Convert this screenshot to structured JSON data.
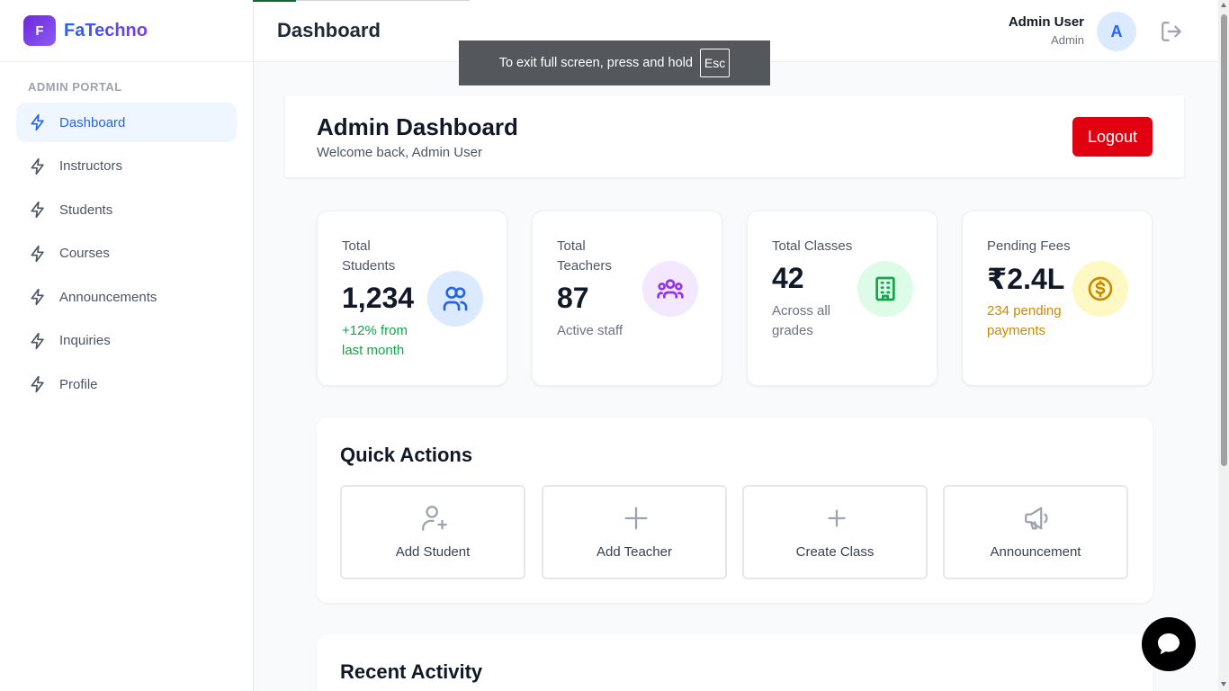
{
  "brand": {
    "logo_letter": "F",
    "name": "FaTechno"
  },
  "sidebar": {
    "section_label": "ADMIN PORTAL",
    "items": [
      {
        "label": "Dashboard",
        "active": true
      },
      {
        "label": "Instructors",
        "active": false
      },
      {
        "label": "Students",
        "active": false
      },
      {
        "label": "Courses",
        "active": false
      },
      {
        "label": "Announcements",
        "active": false
      },
      {
        "label": "Inquiries",
        "active": false
      },
      {
        "label": "Profile",
        "active": false
      }
    ]
  },
  "header": {
    "title": "Dashboard",
    "user_name": "Admin User",
    "user_role": "Admin",
    "avatar_letter": "A"
  },
  "fullscreen_toast": {
    "text": "To exit full screen, press and hold",
    "key": "Esc"
  },
  "admin_card": {
    "title": "Admin Dashboard",
    "subtitle": "Welcome back, Admin User",
    "logout_label": "Logout"
  },
  "stats": [
    {
      "label": "Total Students",
      "value": "1,234",
      "note": "+12% from last month",
      "icon": "users-icon"
    },
    {
      "label": "Total Teachers",
      "value": "87",
      "note": "Active staff",
      "icon": "group-icon"
    },
    {
      "label": "Total Classes",
      "value": "42",
      "note": "Across all grades",
      "icon": "building-icon"
    },
    {
      "label": "Pending Fees",
      "value": "₹2.4L",
      "note": "234 pending payments",
      "icon": "dollar-icon"
    }
  ],
  "quick_actions": {
    "title": "Quick Actions",
    "items": [
      {
        "label": "Add Student",
        "icon": "user-plus-icon"
      },
      {
        "label": "Add Teacher",
        "icon": "plus-icon"
      },
      {
        "label": "Create Class",
        "icon": "plus-icon"
      },
      {
        "label": "Announcement",
        "icon": "megaphone-icon"
      }
    ]
  },
  "recent_activity": {
    "title": "Recent Activity"
  },
  "colors": {
    "accent": "#2563eb",
    "logout_red": "#e00010",
    "success_green": "#16a34a",
    "warning_amber": "#ca8a04"
  }
}
